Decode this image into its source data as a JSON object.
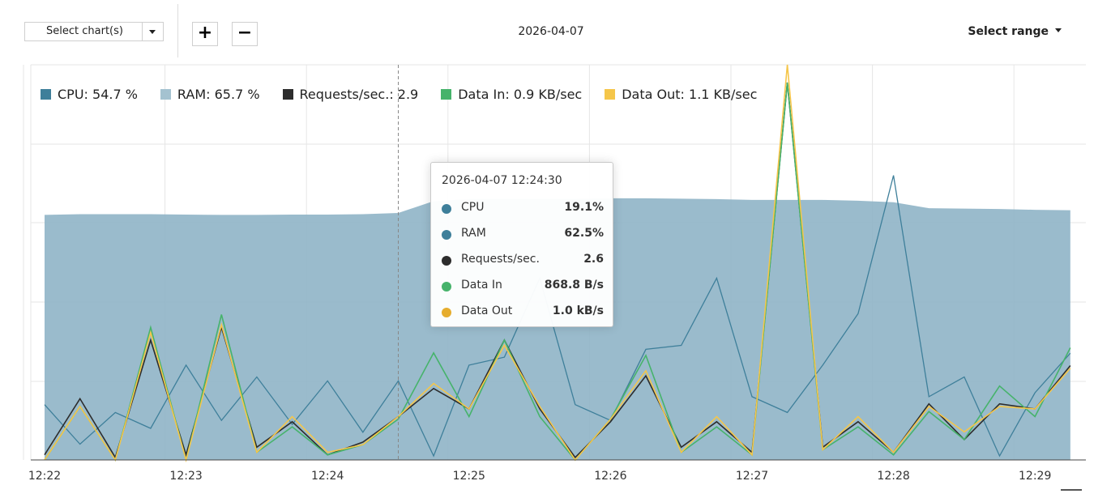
{
  "toolbar": {
    "select_chart_label": "Select chart(s)",
    "zoom_in_label": "+",
    "zoom_out_label": "−",
    "date": "2026-04-07",
    "select_range_label": "Select range"
  },
  "legend": [
    {
      "label": "CPU: 54.7 %",
      "color": "#3e7f9a"
    },
    {
      "label": "RAM: 65.7 %",
      "color": "#a4c2d0"
    },
    {
      "label": "Requests/sec.: 2.9",
      "color": "#2d2d2d"
    },
    {
      "label": "Data In: 0.9 KB/sec",
      "color": "#46b36b"
    },
    {
      "label": "Data Out: 1.1 KB/sec",
      "color": "#f5c64a"
    }
  ],
  "tooltip": {
    "title": "2026-04-07 12:24:30",
    "rows": [
      {
        "name": "CPU",
        "value": "19.1%",
        "color": "#3e7f9a"
      },
      {
        "name": "RAM",
        "value": "62.5%",
        "color": "#3e7f9a"
      },
      {
        "name": "Requests/sec.",
        "value": "2.6",
        "color": "#2d2d2d"
      },
      {
        "name": "Data In",
        "value": "868.8 B/s",
        "color": "#46b36b"
      },
      {
        "name": "Data Out",
        "value": "1.0 kB/s",
        "color": "#e6ad2e"
      }
    ]
  },
  "chart_data": {
    "type": "area",
    "x_ticks": [
      "12:22",
      "12:23",
      "12:24",
      "12:25",
      "12:26",
      "12:27",
      "12:28",
      "12:29"
    ],
    "x_minutes": [
      0,
      0.25,
      0.5,
      0.75,
      1,
      1.25,
      1.5,
      1.75,
      2,
      2.25,
      2.5,
      2.75,
      3,
      3.25,
      3.5,
      3.75,
      4,
      4.25,
      4.5,
      4.75,
      5,
      5.25,
      5.5,
      5.75,
      6,
      6.25,
      6.5,
      6.75,
      7,
      7.25
    ],
    "y_range": [
      0,
      100
    ],
    "grid": true,
    "hover_index": 10,
    "series": [
      {
        "name": "RAM",
        "color": "#8fb4c6",
        "kind": "area",
        "values": [
          62.0,
          62.2,
          62.2,
          62.2,
          62.1,
          62.0,
          62.0,
          62.1,
          62.1,
          62.2,
          62.5,
          65.5,
          66.0,
          66.0,
          66.0,
          66.0,
          66.2,
          66.2,
          66.1,
          66.0,
          65.8,
          65.8,
          65.8,
          65.6,
          65.2,
          63.7,
          63.6,
          63.5,
          63.3,
          63.2
        ]
      },
      {
        "name": "CPU",
        "color": "#3e7f9a",
        "kind": "line",
        "values": [
          14,
          4,
          12,
          8,
          24,
          10,
          21,
          9,
          20,
          7,
          20,
          1,
          24,
          26,
          46,
          14,
          10,
          28,
          29,
          46,
          16,
          12,
          24,
          37,
          72,
          16,
          21,
          1,
          17,
          27
        ]
      },
      {
        "name": "Requests/sec.",
        "color": "#2d2d2d",
        "kind": "line",
        "values": [
          0.2,
          2.4,
          0.1,
          4.7,
          0.2,
          5.2,
          0.5,
          1.5,
          0.2,
          0.7,
          1.7,
          2.8,
          2.0,
          4.7,
          2.0,
          0.1,
          1.5,
          3.3,
          0.5,
          1.5,
          0.3,
          14.8,
          0.5,
          1.5,
          0.3,
          2.2,
          0.8,
          2.2,
          2.0,
          3.7
        ]
      },
      {
        "name": "Data In",
        "color": "#46b36b",
        "kind": "line",
        "values": [
          0.0,
          2.1,
          0.0,
          5.2,
          0.0,
          5.7,
          0.3,
          1.3,
          0.2,
          0.6,
          1.6,
          4.2,
          1.7,
          4.7,
          1.7,
          0.0,
          1.6,
          4.1,
          0.3,
          1.3,
          0.2,
          14.8,
          0.4,
          1.3,
          0.2,
          1.9,
          0.8,
          2.9,
          1.7,
          4.4
        ]
      },
      {
        "name": "Data Out",
        "color": "#f5c64a",
        "kind": "line",
        "values": [
          0.0,
          2.1,
          0.0,
          5.0,
          0.0,
          5.3,
          0.3,
          1.7,
          0.3,
          0.6,
          1.7,
          3.0,
          2.0,
          4.5,
          2.1,
          0.0,
          1.6,
          3.5,
          0.3,
          1.7,
          0.2,
          15.5,
          0.4,
          1.7,
          0.3,
          2.1,
          1.1,
          2.1,
          2.0,
          3.6
        ]
      }
    ]
  }
}
